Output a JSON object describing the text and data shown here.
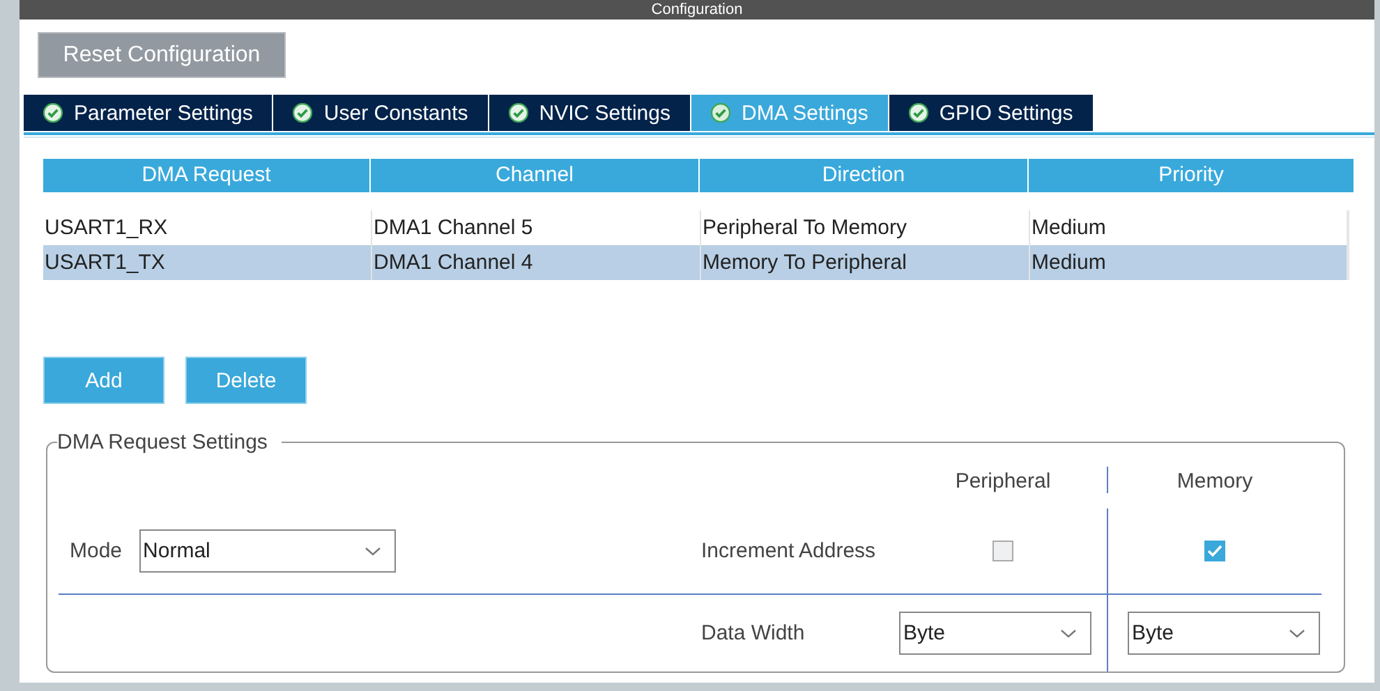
{
  "window": {
    "title": "Configuration"
  },
  "reset_button": "Reset Configuration",
  "tabs": [
    {
      "label": "Parameter Settings",
      "selected": false
    },
    {
      "label": "User Constants",
      "selected": false
    },
    {
      "label": "NVIC Settings",
      "selected": false
    },
    {
      "label": "DMA Settings",
      "selected": true
    },
    {
      "label": "GPIO Settings",
      "selected": false
    }
  ],
  "table": {
    "columns": [
      "DMA Request",
      "Channel",
      "Direction",
      "Priority"
    ],
    "rows": [
      {
        "cells": [
          "USART1_RX",
          "DMA1 Channel 5",
          "Peripheral To Memory",
          "Medium"
        ],
        "selected": false
      },
      {
        "cells": [
          "USART1_TX",
          "DMA1 Channel 4",
          "Memory To Peripheral",
          "Medium"
        ],
        "selected": true
      }
    ]
  },
  "buttons": [
    "Add",
    "Delete"
  ],
  "settings": {
    "title": "DMA Request Settings",
    "mode": {
      "label": "Mode",
      "value": "Normal"
    },
    "columns": [
      "Peripheral",
      "Memory"
    ],
    "increment": {
      "label": "Increment Address",
      "peripheral_checked": false,
      "memory_checked": true
    },
    "data_width": {
      "label": "Data Width",
      "peripheral": "Byte",
      "memory": "Byte"
    }
  }
}
